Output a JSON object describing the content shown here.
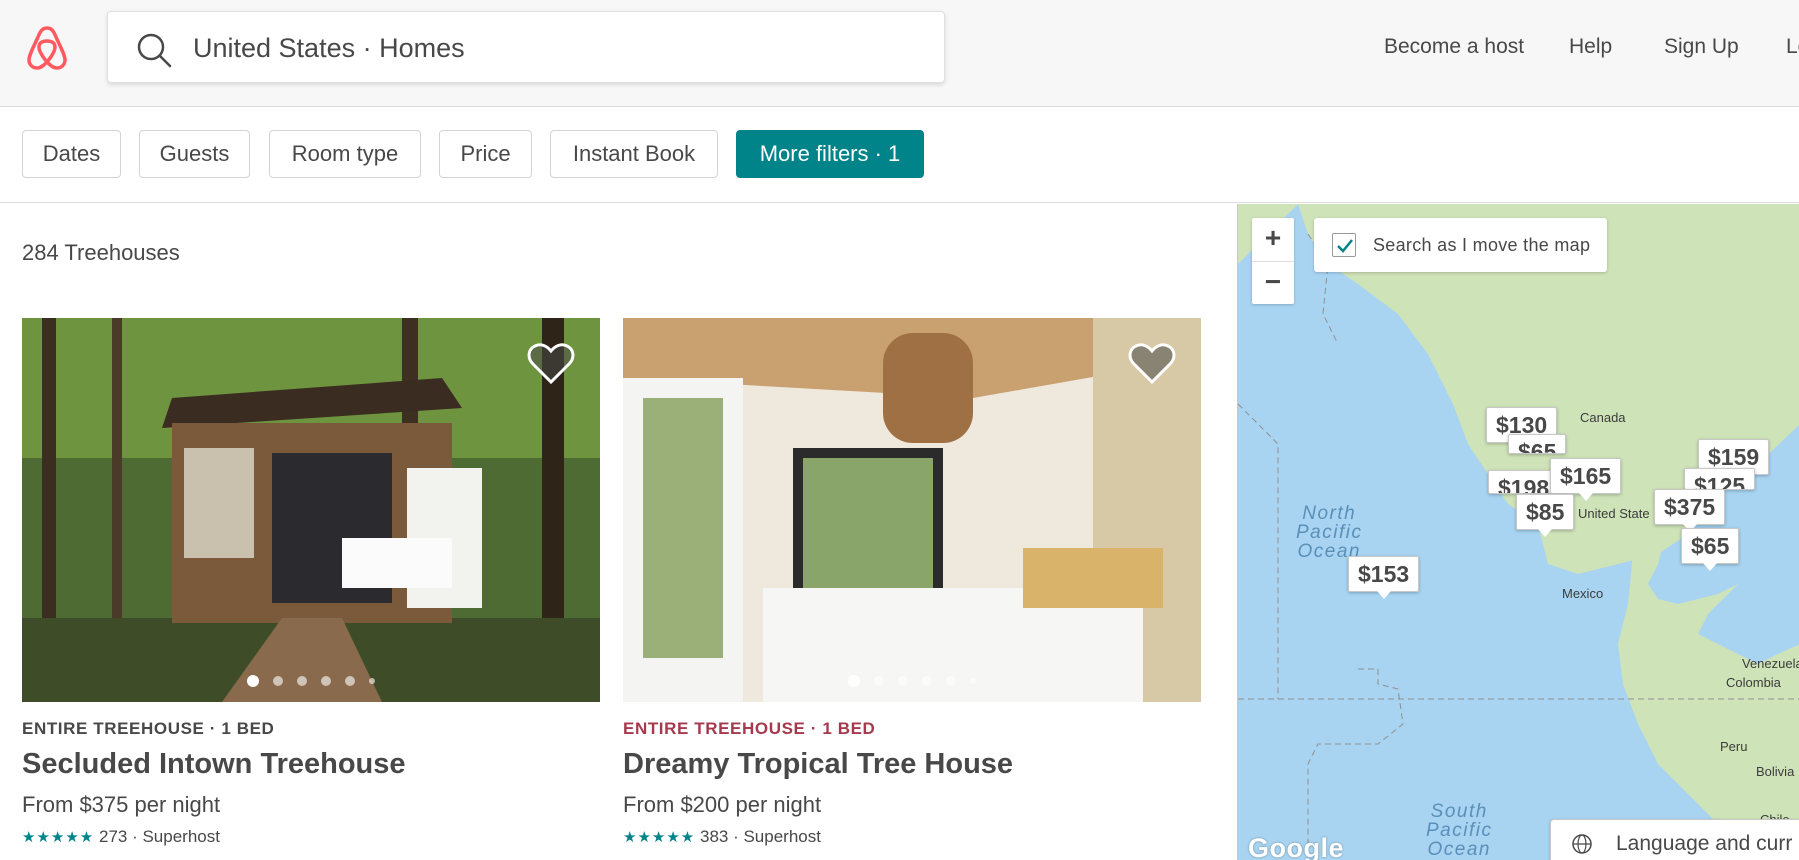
{
  "header": {
    "search_value": "United States · Homes",
    "nav": [
      "Become a host",
      "Help",
      "Sign Up",
      "Lo"
    ]
  },
  "filters": {
    "buttons": [
      "Dates",
      "Guests",
      "Room type",
      "Price",
      "Instant Book"
    ],
    "more": "More filters · 1"
  },
  "results": {
    "count": "284 Treehouses",
    "listings": [
      {
        "kicker": "ENTIRE TREEHOUSE · 1 BED",
        "kicker_color": "#484848",
        "title": "Secluded Intown Treehouse",
        "price": "From $375 per night",
        "stars": "★★★★★",
        "reviews": "273 · Superhost",
        "photo_dots": 6,
        "photo_active": 1
      },
      {
        "kicker": "ENTIRE TREEHOUSE · 1 BED",
        "kicker_color": "#a6394d",
        "title": "Dreamy Tropical Tree House",
        "price": "From $200 per night",
        "stars": "★★★★★",
        "reviews": "383 · Superhost",
        "photo_dots": 6,
        "photo_active": 1
      }
    ]
  },
  "map": {
    "zoom_in": "+",
    "zoom_out": "−",
    "search_as_move": "Search as I move the map",
    "search_as_move_checked": true,
    "pins": [
      "$130",
      "$65",
      "$198",
      "$165",
      "$85",
      "$159",
      "$125",
      "$375",
      "$65",
      "$153"
    ],
    "labels": [
      "Canada",
      "United State",
      "Mexico",
      "Venezuela",
      "Colombia",
      "Peru",
      "Bolivia",
      "Chile"
    ],
    "oceans": [
      "North\nPacific\nOcean",
      "South\nPacific\nOcean"
    ],
    "attribution": "Google",
    "language_button": "Language and curr"
  },
  "colors": {
    "brand": "#ff5a5f",
    "accent": "#008489",
    "map_water": "#a8d4f2",
    "map_land": "#cfe3b8"
  }
}
